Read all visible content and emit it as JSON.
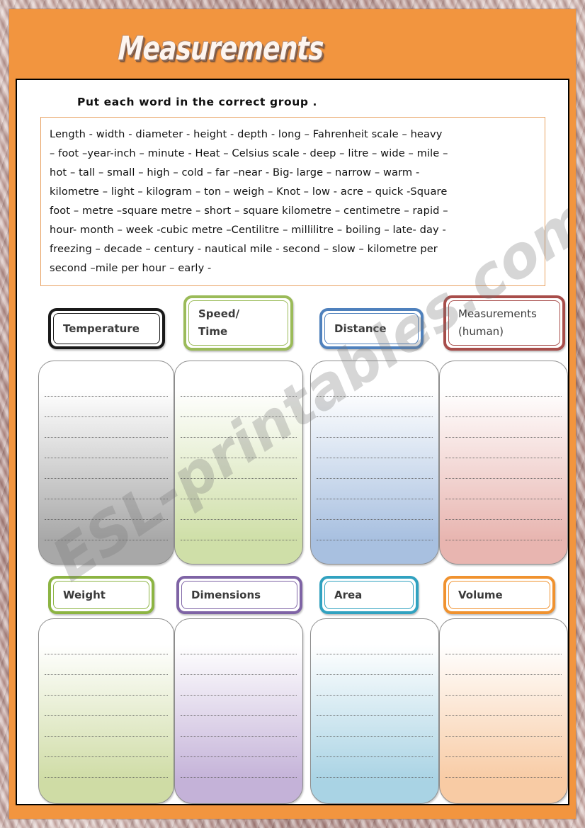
{
  "title": "Measurements",
  "watermark": "ESL-printables.com",
  "instruction": "Put each word in the correct group  .",
  "wordbank": {
    "lines": [
      "Length - width -  diameter  - height -  depth  - long – Fahrenheit scale  – heavy",
      "– foot –year-inch –  minute - Heat – Celsius scale  -  deep – litre – wide – mile –",
      "hot – tall – small – high – cold – far –near - Big- large – narrow – warm -",
      "kilometre – light – kilogram – ton – weigh – Knot – low -  acre – quick  -Square",
      "foot – metre –square metre – short – square kilometre – centimetre – rapid –",
      "hour- month – week -cubic metre –Centilitre – millilitre – boiling – late- day -",
      "freezing – decade – century - nautical mile -  second – slow – kilometre per",
      "second –mile per hour – early -"
    ]
  },
  "colors": {
    "frame_orange": "#f2953f",
    "wordbank_border": "#e8a262",
    "temperature": "#000000",
    "speed_time": "#9bbb59",
    "distance": "#4f81bd",
    "measurements_human": "#a84d4a",
    "weight": "#8cb442",
    "dimensions": "#7e63a5",
    "area": "#31a2c0",
    "volume": "#f0922f"
  },
  "groups": [
    {
      "label": "Temperature",
      "label2": "",
      "accent": "#1a1a1a",
      "fill": "#a8a8a8",
      "lines": 10,
      "bold": true
    },
    {
      "label": "Speed/",
      "label2": "Time",
      "accent": "#9bbb59",
      "fill": "#cfdfa8",
      "lines": 10,
      "bold": true
    },
    {
      "label": "Distance",
      "label2": "",
      "accent": "#4f81bd",
      "fill": "#a8c0e0",
      "lines": 10,
      "bold": true
    },
    {
      "label": "Measurements",
      "label2": "(human)",
      "accent": "#a84d4a",
      "fill": "#e8b5b0",
      "lines": 10,
      "bold": false
    },
    {
      "label": "Weight",
      "label2": "",
      "accent": "#8cb442",
      "fill": "#cfdca5",
      "lines": 9,
      "bold": true
    },
    {
      "label": "Dimensions",
      "label2": "",
      "accent": "#7e63a5",
      "fill": "#c4b2d8",
      "lines": 9,
      "bold": true
    },
    {
      "label": "Area",
      "label2": "",
      "accent": "#31a2c0",
      "fill": "#a9d3e4",
      "lines": 9,
      "bold": true
    },
    {
      "label": "Volume",
      "label2": "",
      "accent": "#f0922f",
      "fill": "#f8cba4",
      "lines": 9,
      "bold": true
    }
  ]
}
